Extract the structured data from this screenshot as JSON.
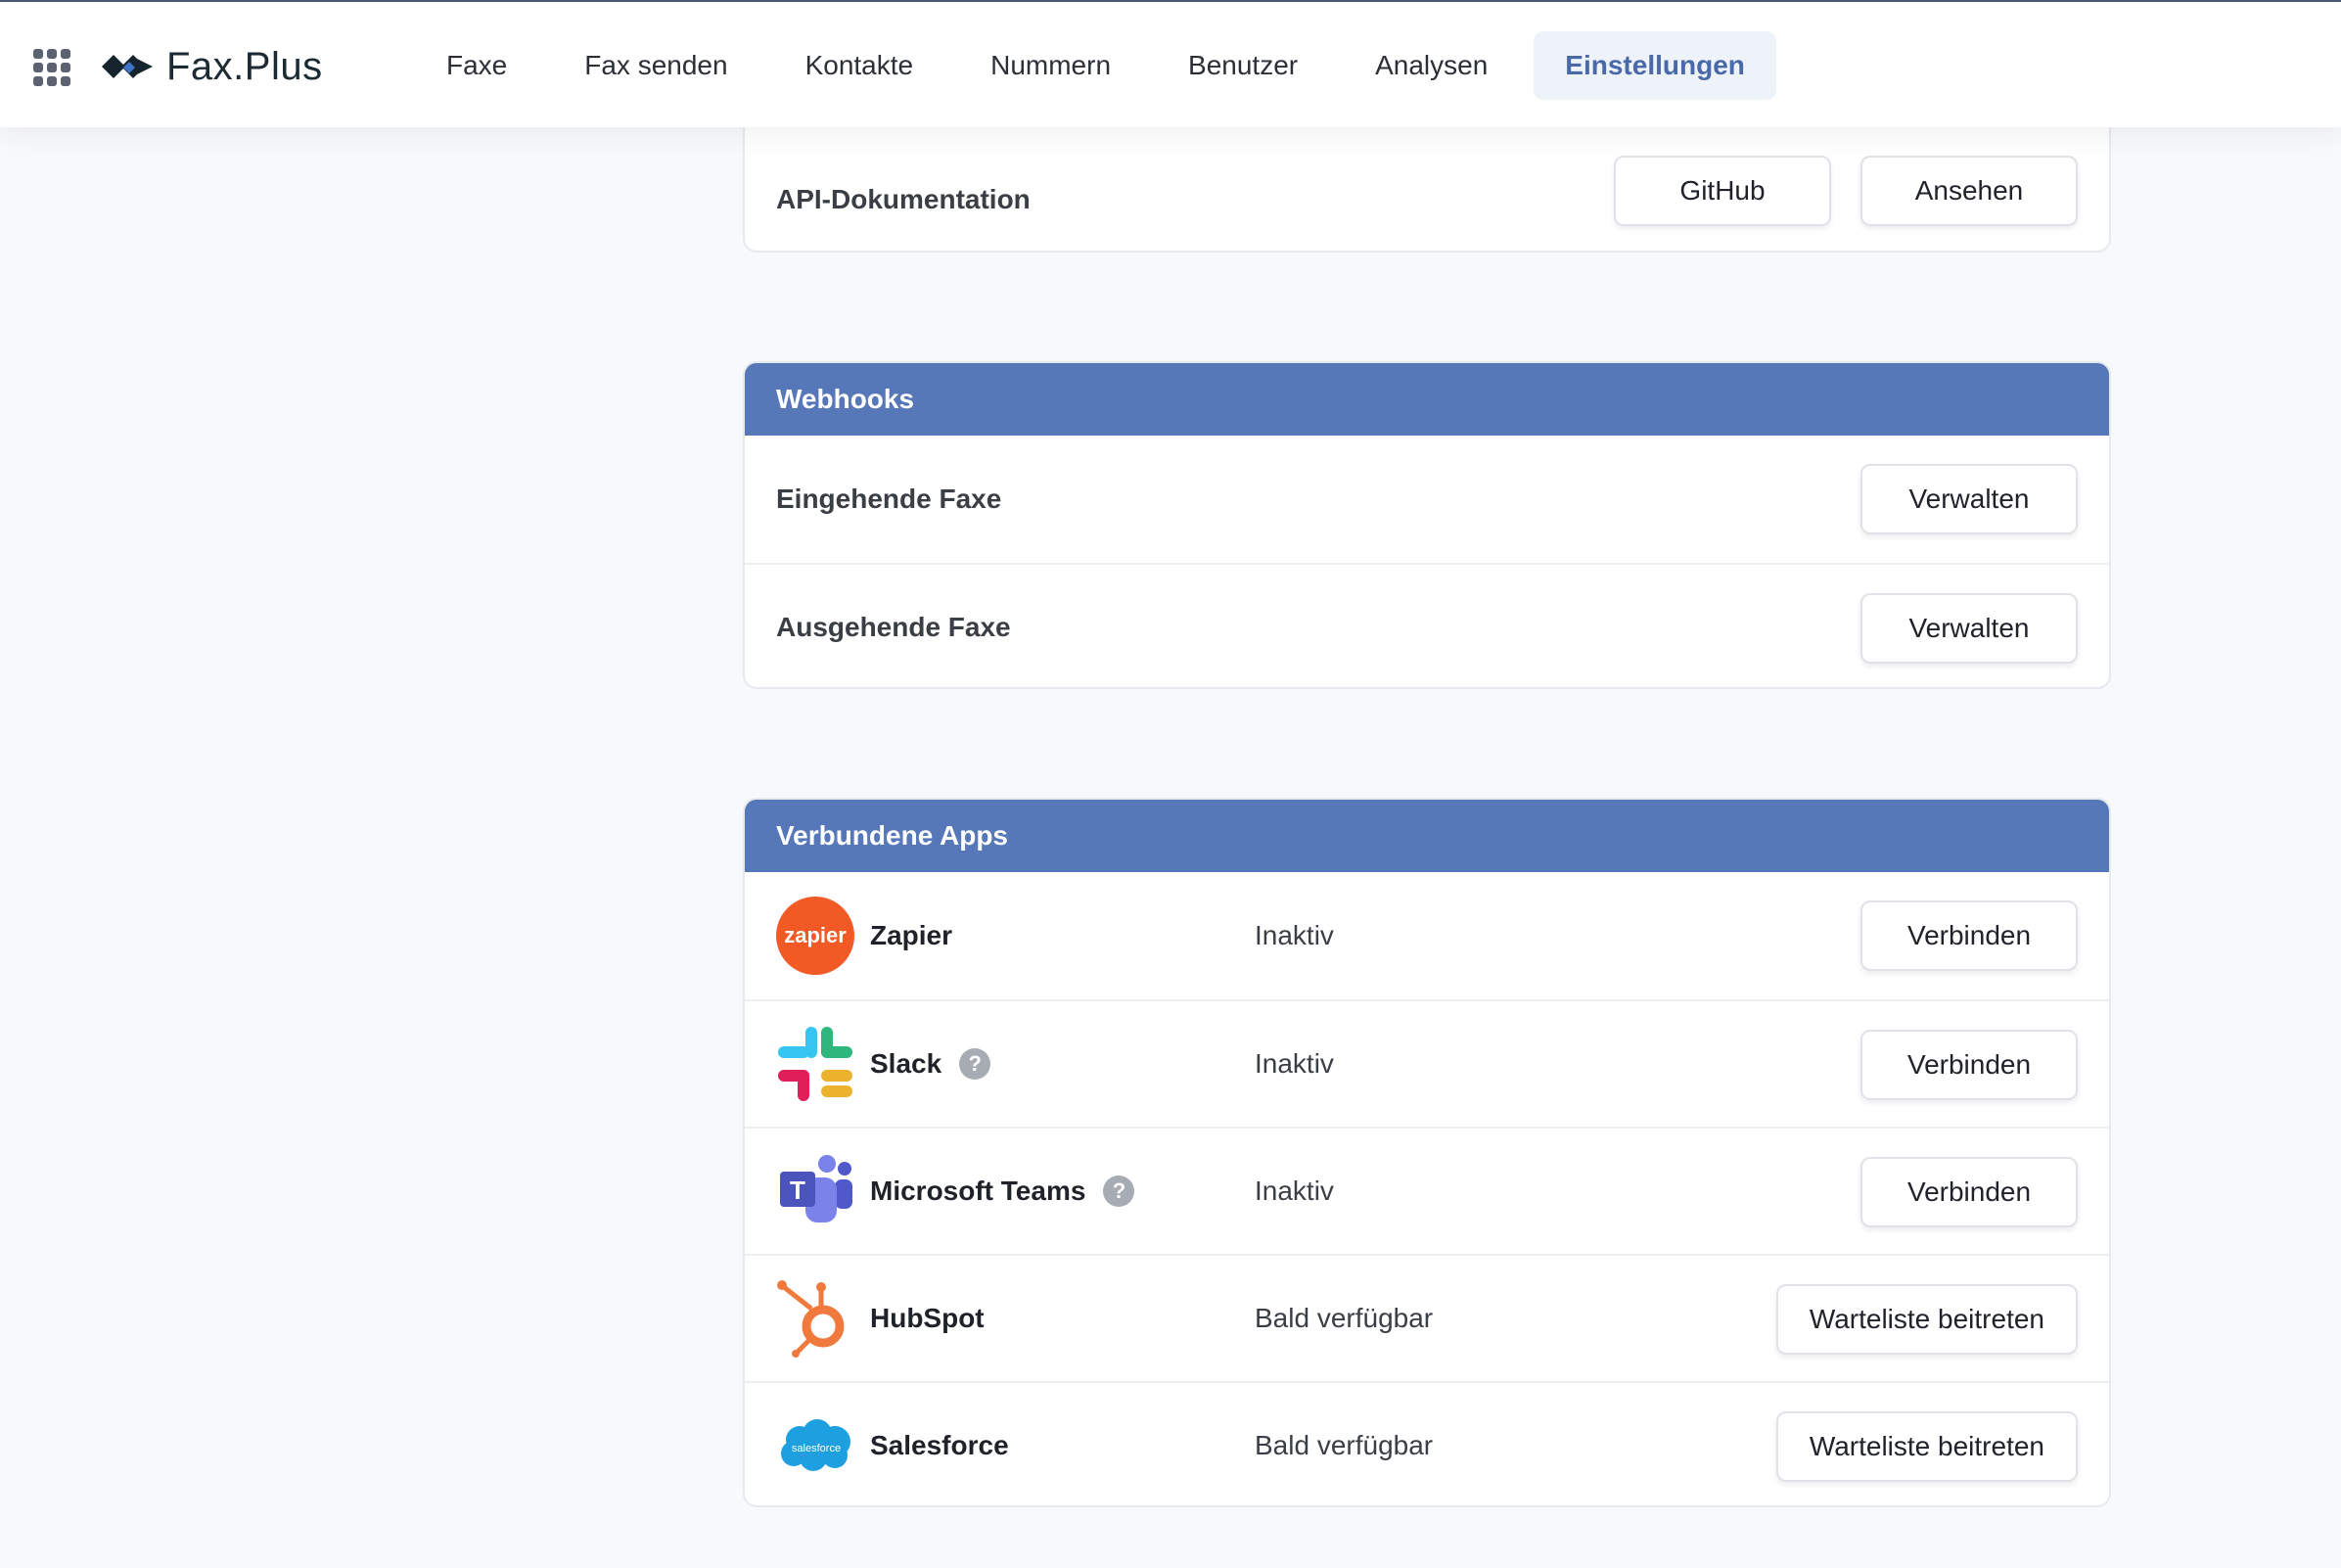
{
  "header": {
    "logo_text": "Fax.Plus",
    "nav": [
      {
        "label": "Faxe"
      },
      {
        "label": "Fax senden"
      },
      {
        "label": "Kontakte"
      },
      {
        "label": "Nummern"
      },
      {
        "label": "Benutzer"
      },
      {
        "label": "Analysen"
      },
      {
        "label": "Einstellungen",
        "active": true
      }
    ]
  },
  "api_docs": {
    "label": "API-Dokumentation",
    "github_button": "GitHub",
    "view_button": "Ansehen"
  },
  "webhooks": {
    "title": "Webhooks",
    "rows": [
      {
        "label": "Eingehende Faxe",
        "button": "Verwalten"
      },
      {
        "label": "Ausgehende Faxe",
        "button": "Verwalten"
      }
    ]
  },
  "connected_apps": {
    "title": "Verbundene Apps",
    "apps": [
      {
        "name": "Zapier",
        "icon": "zapier-logo",
        "icon_text": "zapier",
        "status": "Inaktiv",
        "button": "Verbinden",
        "help": false
      },
      {
        "name": "Slack",
        "icon": "slack-logo",
        "status": "Inaktiv",
        "button": "Verbinden",
        "help": true
      },
      {
        "name": "Microsoft Teams",
        "icon": "microsoft-teams-logo",
        "icon_text": "T",
        "status": "Inaktiv",
        "button": "Verbinden",
        "help": true
      },
      {
        "name": "HubSpot",
        "icon": "hubspot-logo",
        "status": "Bald verfügbar",
        "button": "Warteliste beitreten",
        "help": false
      },
      {
        "name": "Salesforce",
        "icon": "salesforce-logo",
        "icon_text": "salesforce",
        "status": "Bald verfügbar",
        "button": "Warteliste beitreten",
        "help": false
      }
    ],
    "help_glyph": "?"
  },
  "colors": {
    "accent": "#5677b8",
    "nav_active_bg": "#eef2f9",
    "nav_active_text": "#4a69a8",
    "page_bg": "#f8f9fb",
    "zapier": "#ff4f00",
    "hubspot": "#f07a3e",
    "salesforce": "#1ea0e0",
    "teams": "#5059c9"
  }
}
